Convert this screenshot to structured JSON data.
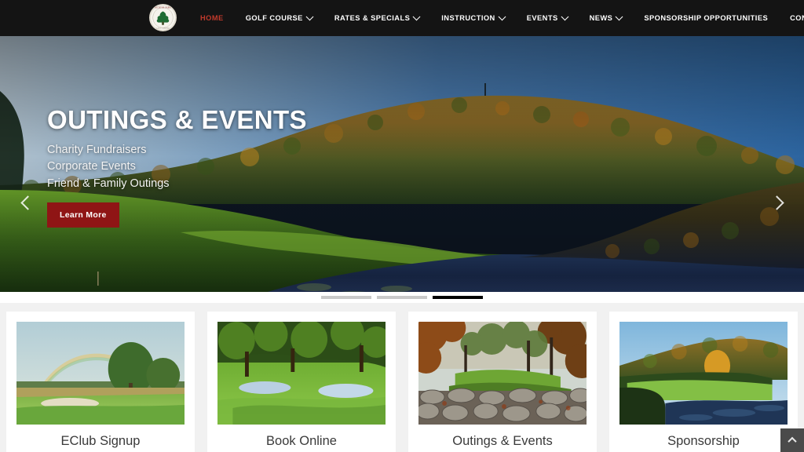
{
  "site": {
    "logo": {
      "icon": "oak-tree-badge-icon",
      "top_text": "RICHTER PARK",
      "bottom_text": "GOLF COURSE"
    }
  },
  "nav": {
    "items": [
      {
        "label": "HOME",
        "has_dropdown": false,
        "active": true
      },
      {
        "label": "GOLF COURSE",
        "has_dropdown": true,
        "active": false
      },
      {
        "label": "RATES & SPECIALS",
        "has_dropdown": true,
        "active": false
      },
      {
        "label": "INSTRUCTION",
        "has_dropdown": true,
        "active": false
      },
      {
        "label": "EVENTS",
        "has_dropdown": true,
        "active": false
      },
      {
        "label": "NEWS",
        "has_dropdown": true,
        "active": false
      },
      {
        "label": "SPONSORSHIP OPPORTUNITIES",
        "has_dropdown": false,
        "active": false
      },
      {
        "label": "CONTACT US",
        "has_dropdown": false,
        "active": false
      }
    ],
    "active_color": "#c0392b",
    "bar_color": "#141414"
  },
  "hero": {
    "title": "OUTINGS & EVENTS",
    "subtitle_lines": [
      "Charity Fundraisers",
      "Corporate Events",
      "Friend & Family Outings"
    ],
    "cta_label": "Learn More",
    "cta_color": "#8f1515",
    "prev_icon": "chevron-left-icon",
    "next_icon": "chevron-right-icon",
    "slides": [
      {
        "active": false
      },
      {
        "active": false
      },
      {
        "active": true
      }
    ]
  },
  "cards": [
    {
      "caption": "EClub Signup",
      "image": "golf-course-rainbow-photo"
    },
    {
      "caption": "Book Online",
      "image": "golf-fairway-bunkers-photo"
    },
    {
      "caption": "Outings & Events",
      "image": "stone-wall-autumn-photo"
    },
    {
      "caption": "Sponsorship",
      "image": "autumn-lake-green-photo"
    }
  ],
  "scroll_top": {
    "icon": "chevron-up-icon"
  }
}
